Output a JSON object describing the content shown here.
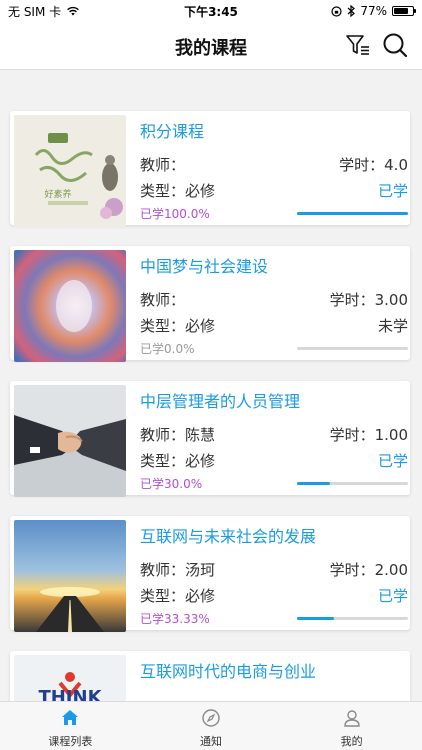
{
  "status_bar": {
    "carrier": "无 SIM 卡",
    "time": "下午3:45",
    "battery": "77%",
    "battery_level": 0.77
  },
  "nav": {
    "title": "我的课程",
    "filter_icon": "filter-icon",
    "search_icon": "search-icon"
  },
  "colors": {
    "accent": "#1a9be6",
    "progress_purple": "#b14fd8",
    "progress_gray": "#999999"
  },
  "courses": [
    {
      "title": "积分课程",
      "teacher": "教师：",
      "hours": "学时：4.0",
      "type": "类型：必修",
      "status": "已学",
      "progress_text": "已学100.0%",
      "progress": 1.0,
      "thumb_text": "好素养"
    },
    {
      "title": "中国梦与社会建设",
      "teacher": "教师：",
      "hours": "学时：3.00",
      "type": "类型：必修",
      "status": "未学",
      "progress_text": "已学0.0%",
      "progress": 0.0,
      "thumb_text": ""
    },
    {
      "title": "中层管理者的人员管理",
      "teacher": "教师：陈慧",
      "hours": "学时：1.00",
      "type": "类型：必修",
      "status": "已学",
      "progress_text": "已学30.0%",
      "progress": 0.3,
      "thumb_text": ""
    },
    {
      "title": "互联网与未来社会的发展",
      "teacher": "教师：汤珂",
      "hours": "学时：2.00",
      "type": "类型：必修",
      "status": "已学",
      "progress_text": "已学33.33%",
      "progress": 0.3333,
      "thumb_text": ""
    },
    {
      "title": "互联网时代的电商与创业",
      "teacher": "",
      "hours": "",
      "type": "",
      "status": "",
      "progress_text": "",
      "progress": 0.0,
      "thumb_text": "THINK"
    }
  ],
  "tabs": [
    {
      "label": "课程列表",
      "icon": "home-icon",
      "active": true
    },
    {
      "label": "通知",
      "icon": "compass-icon",
      "active": false
    },
    {
      "label": "我的",
      "icon": "user-icon",
      "active": false
    }
  ]
}
